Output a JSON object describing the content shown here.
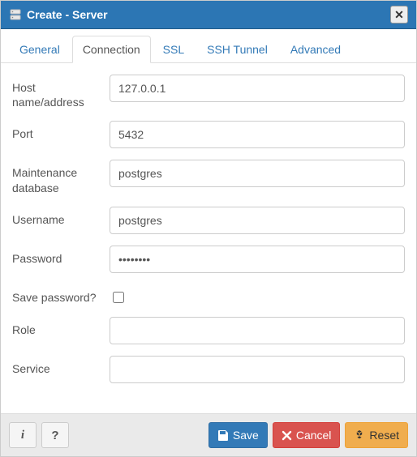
{
  "dialog": {
    "title": "Create - Server"
  },
  "tabs": {
    "general": "General",
    "connection": "Connection",
    "ssl": "SSL",
    "ssh": "SSH Tunnel",
    "advanced": "Advanced"
  },
  "labels": {
    "host": "Host name/address",
    "port": "Port",
    "maintdb": "Maintenance database",
    "username": "Username",
    "password": "Password",
    "savepw": "Save password?",
    "role": "Role",
    "service": "Service"
  },
  "values": {
    "host": "127.0.0.1",
    "port": "5432",
    "maintdb": "postgres",
    "username": "postgres",
    "password": "••••••••",
    "role": "",
    "service": ""
  },
  "buttons": {
    "info": "i",
    "help": "?",
    "save": "Save",
    "cancel": "Cancel",
    "reset": "Reset"
  }
}
